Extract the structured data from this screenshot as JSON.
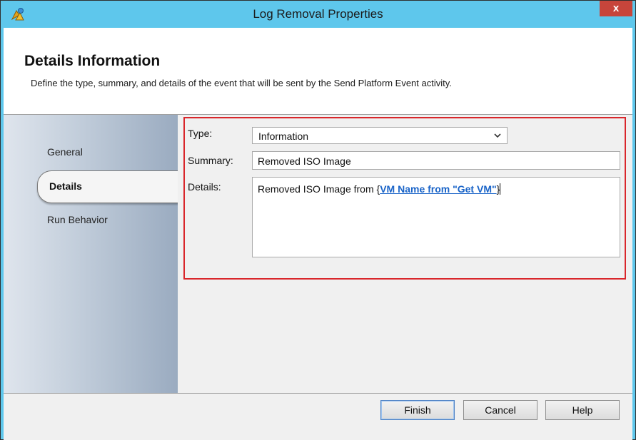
{
  "window": {
    "title": "Log Removal Properties",
    "close_label": "x",
    "app_icon": "properties-wizard-icon"
  },
  "header": {
    "title": "Details Information",
    "description": "Define the type, summary, and details of the event that will be sent by the Send Platform Event activity."
  },
  "sidebar": {
    "items": [
      {
        "label": "General",
        "active": false
      },
      {
        "label": "Details",
        "active": true
      },
      {
        "label": "Run Behavior",
        "active": false
      }
    ]
  },
  "form": {
    "type_label": "Type:",
    "type_value": "Information",
    "summary_label": "Summary:",
    "summary_value": "Removed ISO Image",
    "details_label": "Details:",
    "details_prefix": "Removed ISO Image from ",
    "details_open_brace": "{",
    "details_token": "VM Name from \"Get VM\"",
    "details_close_brace": "}"
  },
  "footer": {
    "finish_label": "Finish",
    "cancel_label": "Cancel",
    "help_label": "Help"
  },
  "colors": {
    "titlebar": "#5ec7ec",
    "close_button": "#c7453b",
    "highlight_border": "#d9262b",
    "token_link": "#1a64c8"
  }
}
